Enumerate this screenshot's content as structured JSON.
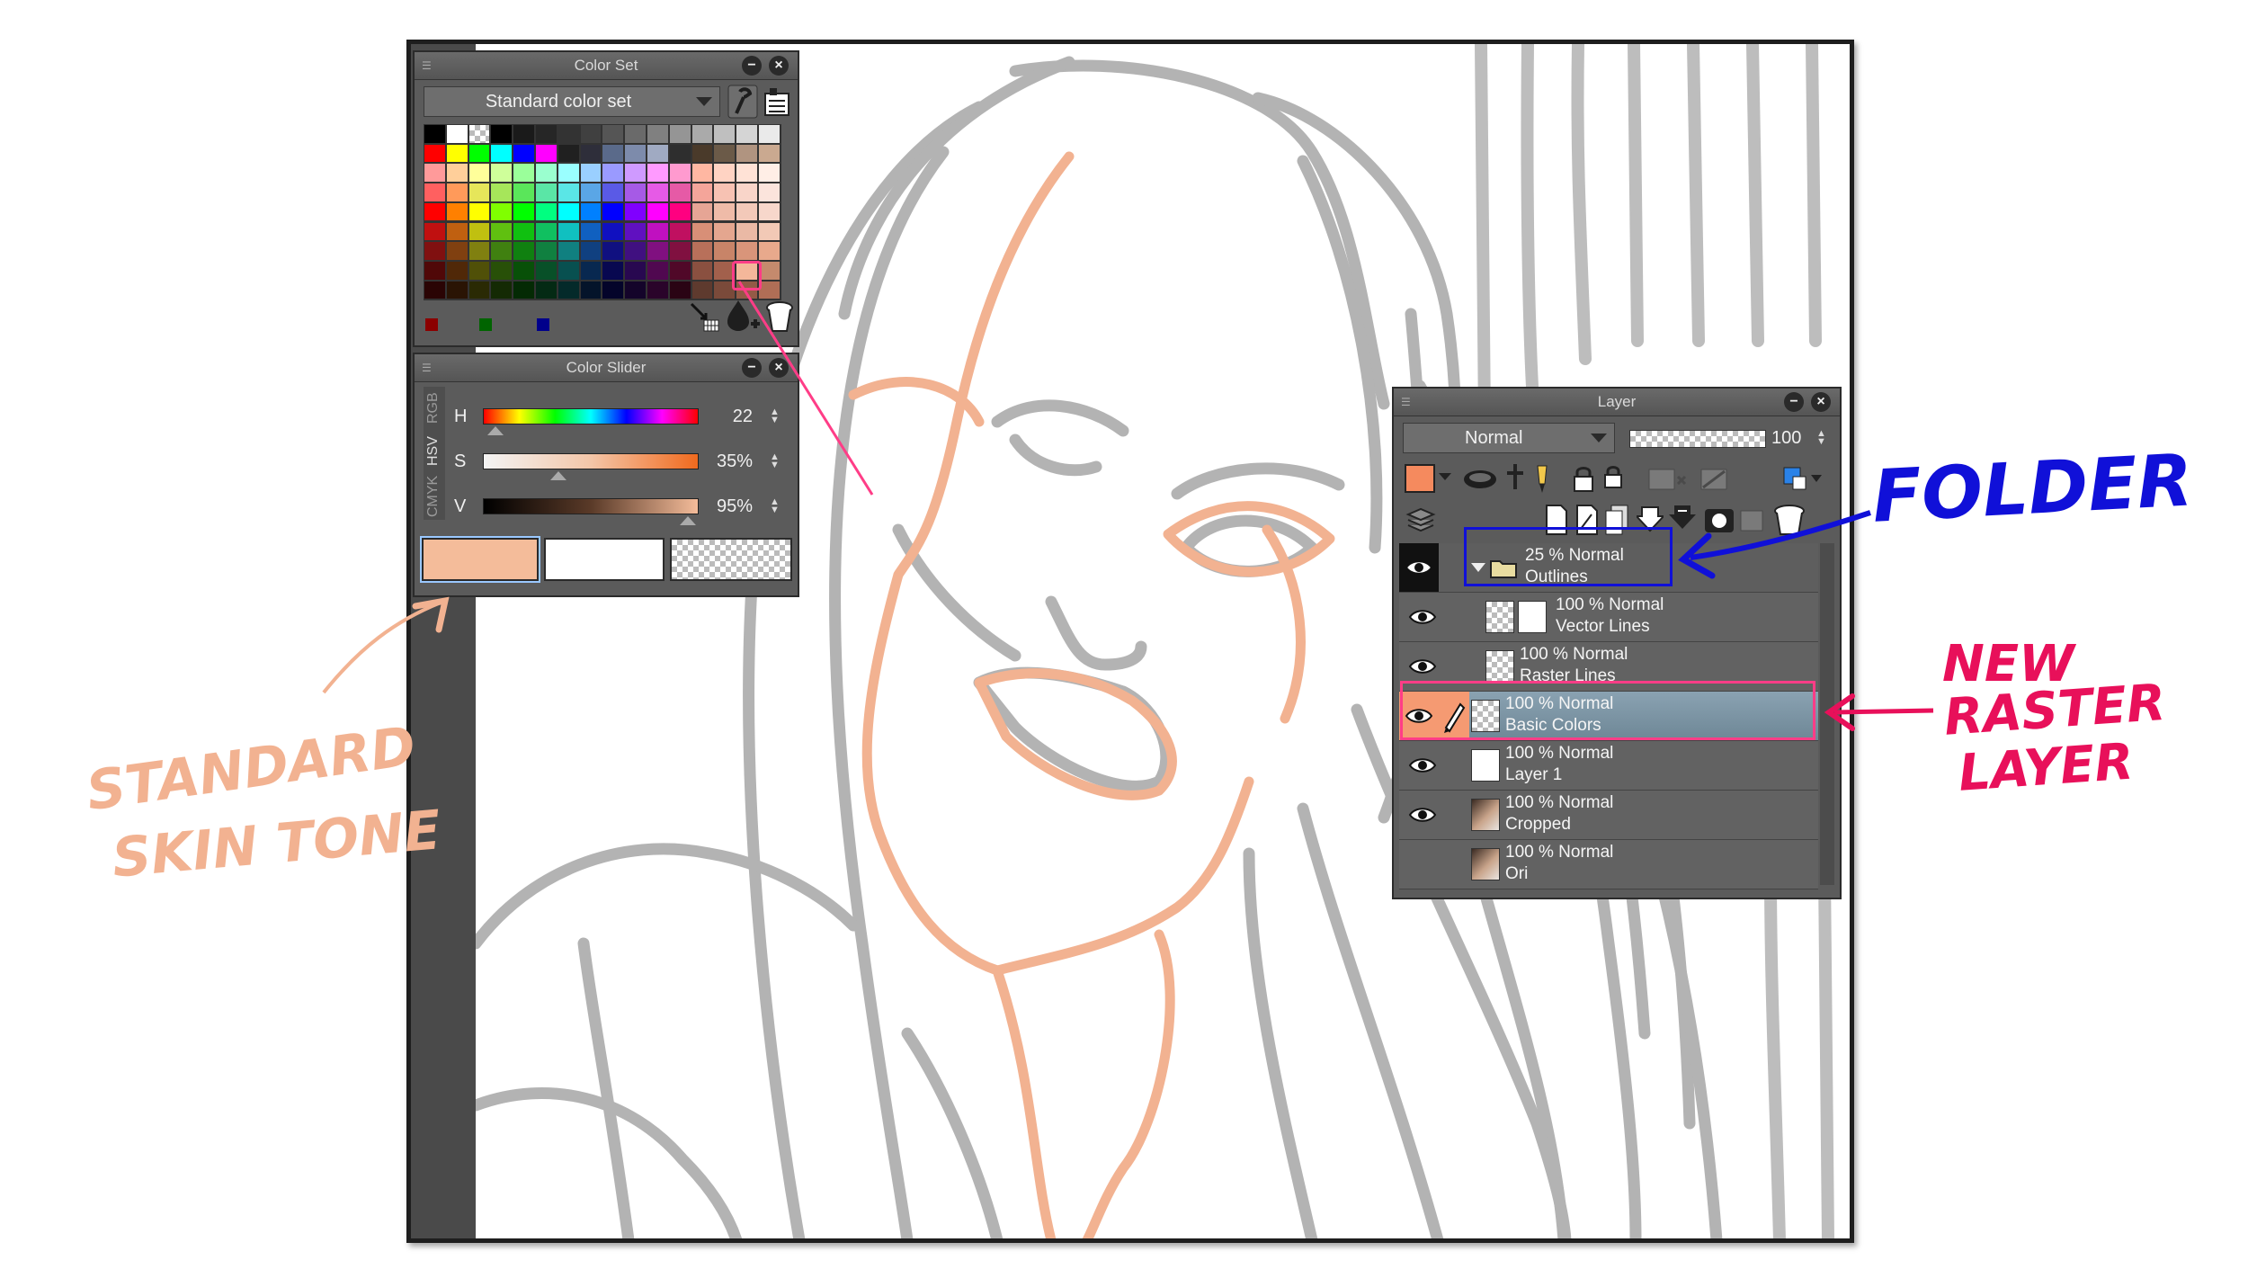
{
  "color_set": {
    "title": "Color Set",
    "set_name": "Standard color set",
    "icons": [
      "settings-wrench-icon",
      "color-set-options-icon",
      "add-color-icon",
      "eyedropper-add-icon",
      "delete-color-icon"
    ],
    "swatch_rows": [
      [
        "#000000",
        "#ffffff",
        "checker",
        "#000000",
        "#1a1a1a",
        "#262626",
        "#333333",
        "#404040",
        "#555555",
        "#6a6a6a",
        "#808080",
        "#959595",
        "#aaaaaa",
        "#bfbfbf",
        "#d5d5d5",
        "#eaeaea"
      ],
      [
        "#ff0000",
        "#ffff00",
        "#00ff00",
        "#00ffff",
        "#0000ff",
        "#ff00ff",
        "#202020",
        "#2e2e3a",
        "#5a6a8a",
        "#7d8bab",
        "#a0aac2",
        "#2e2e2e",
        "#4a3a2a",
        "#6b5a48",
        "#b09480",
        "#caa990"
      ],
      [
        "#ff9a9a",
        "#ffcf9a",
        "#ffff9a",
        "#cfff9a",
        "#9aff9a",
        "#9affcf",
        "#9affff",
        "#9acfff",
        "#9a9aff",
        "#cf9aff",
        "#ff9aff",
        "#ff9acf",
        "#ffb7a2",
        "#ffd3c3",
        "#ffe2d6",
        "#ffeee6"
      ],
      [
        "#ff6060",
        "#ff9a5a",
        "#e6e65a",
        "#a6e65a",
        "#5ae65a",
        "#5ae6a6",
        "#5ae6e6",
        "#5aa6e6",
        "#5a5ae6",
        "#a65ae6",
        "#e65ae6",
        "#e65aa6",
        "#f4a59a",
        "#f7c2b3",
        "#f9d5c9",
        "#fbe4dc"
      ],
      [
        "#ff0000",
        "#ff8000",
        "#ffff00",
        "#80ff00",
        "#00ff00",
        "#00ff80",
        "#00ffff",
        "#0080ff",
        "#0000ff",
        "#8000ff",
        "#ff00ff",
        "#ff0080",
        "#e6a595",
        "#efbba8",
        "#f3c9b9",
        "#f7d7cb"
      ],
      [
        "#c01010",
        "#c06010",
        "#c0c010",
        "#60c010",
        "#10c010",
        "#10c060",
        "#10c0c0",
        "#1060c0",
        "#1010c0",
        "#6010c0",
        "#c010c0",
        "#c01060",
        "#d88f77",
        "#e4a68f",
        "#eab9a5",
        "#f2c9b6"
      ],
      [
        "#801010",
        "#804010",
        "#808010",
        "#408010",
        "#108010",
        "#108040",
        "#108080",
        "#104080",
        "#101080",
        "#401080",
        "#801080",
        "#801040",
        "#b8705a",
        "#c88468",
        "#d9957a",
        "#e8a98c"
      ],
      [
        "#500808",
        "#502808",
        "#505008",
        "#285008",
        "#085008",
        "#085028",
        "#085050",
        "#082850",
        "#080850",
        "#280850",
        "#500850",
        "#500828",
        "#8a5040",
        "#a2604c",
        "#f4b79a",
        "#c58a6d"
      ],
      [
        "#2a0404",
        "#2a1404",
        "#2a2a04",
        "#142a04",
        "#042a04",
        "#042a14",
        "#042a2a",
        "#04142a",
        "#04042a",
        "#14042a",
        "#2a042a",
        "#2a0414",
        "#5e3a2e",
        "#7a4a3a",
        "#945a46",
        "#b06e56"
      ]
    ],
    "bottom_colors": [
      "#8b0000",
      "#006400",
      "#00008b"
    ]
  },
  "color_slider": {
    "title": "Color Slider",
    "tabs": [
      "RGB",
      "HSV",
      "CMYK"
    ],
    "active_tab": "HSV",
    "sliders": [
      {
        "label": "H",
        "value": "22",
        "position": 0.06
      },
      {
        "label": "S",
        "value": "35%",
        "position": 0.35
      },
      {
        "label": "V",
        "value": "95%",
        "position": 0.95
      }
    ],
    "main_color": "#f4bc9a",
    "sub_color": "#ffffff"
  },
  "layer_panel": {
    "title": "Layer",
    "blend_mode": "Normal",
    "opacity": "100",
    "layers": [
      {
        "opacity": "25 %",
        "mode": "Normal",
        "name": "Outlines",
        "kind": "folder",
        "visible": true,
        "selected": false
      },
      {
        "opacity": "100 %",
        "mode": "Normal",
        "name": "Vector Lines",
        "kind": "vector",
        "visible": true,
        "selected": false
      },
      {
        "opacity": "100 %",
        "mode": "Normal",
        "name": "Raster Lines",
        "kind": "raster",
        "visible": true,
        "selected": false
      },
      {
        "opacity": "100 %",
        "mode": "Normal",
        "name": "Basic Colors",
        "kind": "raster",
        "visible": true,
        "selected": true
      },
      {
        "opacity": "100 %",
        "mode": "Normal",
        "name": "Layer 1",
        "kind": "paper",
        "visible": true,
        "selected": false
      },
      {
        "opacity": "100 %",
        "mode": "Normal",
        "name": "Cropped",
        "kind": "photo",
        "visible": true,
        "selected": false
      },
      {
        "opacity": "100 %",
        "mode": "Normal",
        "name": "Ori",
        "kind": "photo",
        "visible": false,
        "selected": false
      }
    ]
  },
  "annotations": {
    "skin": [
      "STANDARD",
      "SKIN TONE"
    ],
    "folder": "FOLDER",
    "raster": [
      "NEW",
      "RASTER",
      "LAYER"
    ]
  },
  "colors": {
    "skin_accent": "#f4b79a",
    "folder_note": "#1010d8",
    "raster_note": "#e8105a",
    "sketch_gray": "#b3b3b3"
  }
}
